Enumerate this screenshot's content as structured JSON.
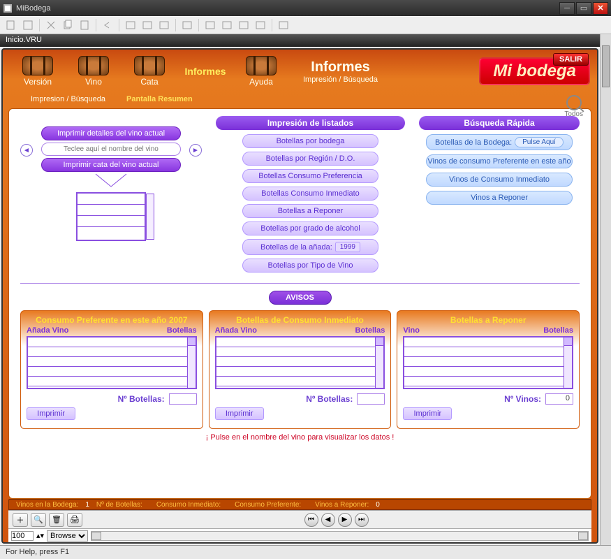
{
  "window": {
    "title": "MiBodega"
  },
  "subtitle": "Inicio.VRU",
  "nav": {
    "items": [
      {
        "label": "Versión"
      },
      {
        "label": "Vino"
      },
      {
        "label": "Cata"
      },
      {
        "label": "Informes"
      },
      {
        "label": "Ayuda"
      }
    ],
    "heading_title": "Informes",
    "heading_sub": "Impresión / Búsqueda",
    "brand": "Mi bodega",
    "salir": "SALIR"
  },
  "subnav": {
    "a": "Impresion / Búsqueda",
    "b": "Pantalla Resumen"
  },
  "left": {
    "btn1": "Imprimir detalles del vino actual",
    "input_placeholder": "Teclee aquí el nombre del vino",
    "btn2": "Imprimir cata del vino actual"
  },
  "print_list": {
    "header": "Impresión de listados",
    "items": [
      "Botellas por bodega",
      "Botellas por Región / D.O.",
      "Botellas Consumo Preferencia",
      "Botellas Consumo Inmediato",
      "Botellas a Reponer",
      "Botellas por grado de alcohol"
    ],
    "anada_label": "Botellas de la añada:",
    "anada_year": "1999",
    "tipo": "Botellas por Tipo de Vino"
  },
  "quick": {
    "header": "Búsqueda Rápida",
    "bodega_label": "Botellas de la Bodega:",
    "bodega_btn": "Pulse Aquí",
    "items": [
      "Vinos de consumo Preferente en este año",
      "Vinos de Consumo Inmediato",
      "Vinos a Reponer"
    ]
  },
  "search_all": "Todos",
  "avisos": "AVISOS",
  "panels": [
    {
      "title": "Consumo Preferente en este año 2007",
      "col_a": "Añada Vino",
      "col_b": "Botellas",
      "footer_label": "Nº Botellas:",
      "footer_val": "",
      "print": "Imprimir"
    },
    {
      "title": "Botellas de Consumo Inmediato",
      "col_a": "Añada Vino",
      "col_b": "Botellas",
      "footer_label": "Nº Botellas:",
      "footer_val": "",
      "print": "Imprimir"
    },
    {
      "title": "Botellas a Reponer",
      "col_a": "Vino",
      "col_b": "Botellas",
      "footer_label": "Nº Vinos:",
      "footer_val": "0",
      "print": "Imprimir"
    }
  ],
  "hint": "¡ Pulse en el nombre del vino para visualizar los datos !",
  "status": {
    "bodega_lbl": "Vinos en la Bodega:",
    "bodega_v": "1",
    "botellas_lbl": "Nº de Botellas:",
    "botellas_v": "",
    "inmed_lbl": "Consumo Inmediato:",
    "inmed_v": "",
    "pref_lbl": "Consumo Preferente:",
    "pref_v": "",
    "repo_lbl": "Vinos a Reponer:",
    "repo_v": "0"
  },
  "numbar": {
    "value": "100",
    "mode": "Browse"
  },
  "helpbar": "For Help, press F1"
}
